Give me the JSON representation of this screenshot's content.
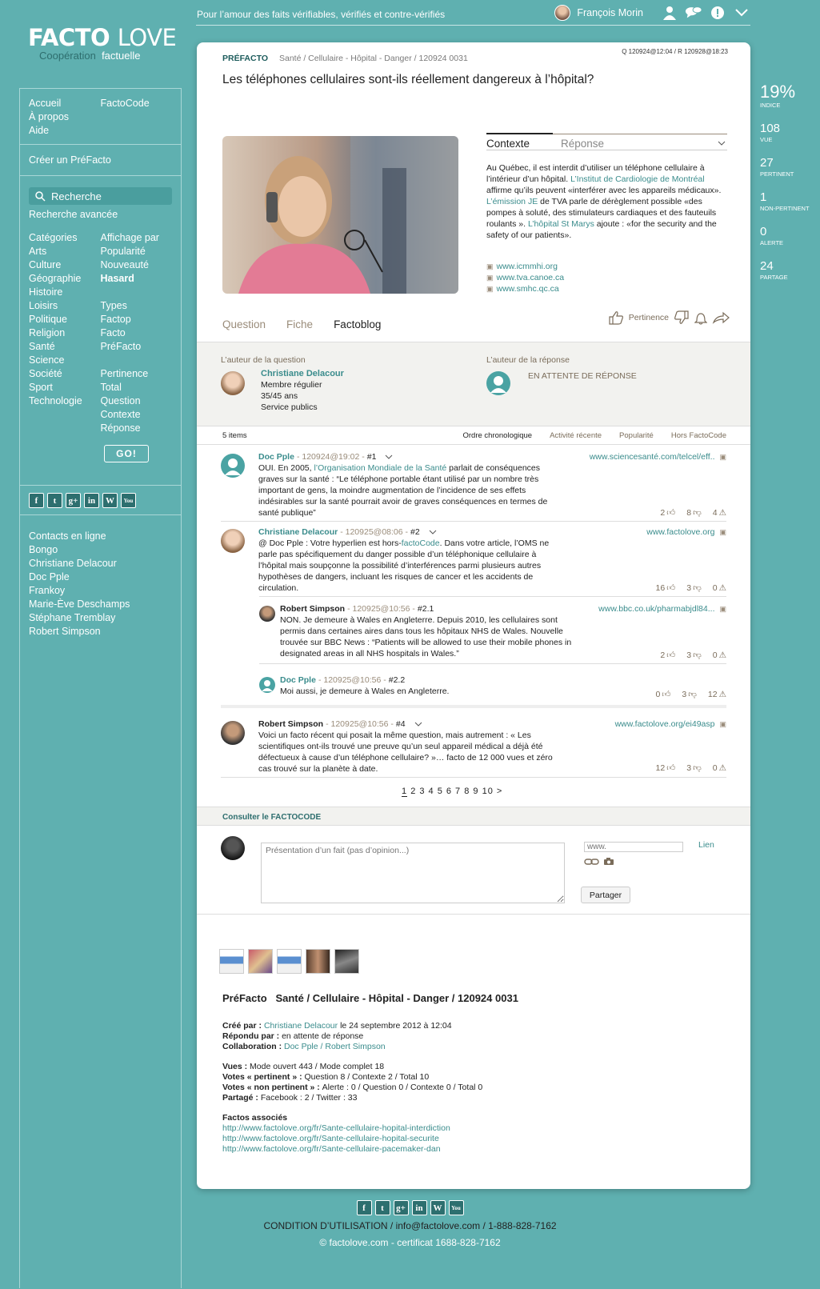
{
  "top": {
    "tagline": "Pour l’amour des faits vérifiables, vérifiés et contre-vérifiés",
    "user_name": "François Morin"
  },
  "logo": {
    "word1": "FACTO",
    "word2": "LOVE",
    "sub1": "Coopération",
    "sub2": "factuelle"
  },
  "sidebar": {
    "nav_left": [
      "Accueil",
      "À propos",
      "Aide"
    ],
    "nav_right": [
      "FactoCode"
    ],
    "create": "Créer un PréFacto",
    "search_label": "Recherche",
    "advanced_search": "Recherche avancée",
    "categories_title": "Catégories",
    "categories": [
      "Arts",
      "Culture",
      "Géographie",
      "Histoire",
      "Loisirs",
      "Politique",
      "Religion",
      "Santé",
      "Science",
      "Société",
      "Sport",
      "Technologie"
    ],
    "display_title": "Affichage par",
    "display": [
      "Popularité",
      "Nouveauté",
      "Hasard"
    ],
    "types_title": "Types",
    "types": [
      "Factop",
      "Facto",
      "PréFacto"
    ],
    "relevance_title": "Pertinence",
    "relevance": [
      "Total",
      "Question",
      "Contexte",
      "Réponse"
    ],
    "go_label": "GO!",
    "contacts_title": "Contacts en ligne",
    "contacts": [
      "Bongo",
      "Christiane Delacour",
      "Doc Pple",
      "Frankoy",
      "Marie-Ève Deschamps",
      "Stéphane Tremblay",
      "Robert Simpson"
    ]
  },
  "social_icons": [
    "f",
    "t",
    "g+",
    "in",
    "W",
    "You"
  ],
  "stats": [
    {
      "value": "19%",
      "label": "INDICE"
    },
    {
      "value": "108",
      "label": "VUE"
    },
    {
      "value": "27",
      "label": "PERTINENT"
    },
    {
      "value": "1",
      "label": "NON-PERTINENT"
    },
    {
      "value": "0",
      "label": "ALERTE"
    },
    {
      "value": "24",
      "label": "PARTAGE"
    }
  ],
  "question": {
    "type": "PRÉFACTO",
    "path": "Santé / Cellulaire - Hôpital - Danger / 120924 0031",
    "dates": "Q 120924@12:04 / R 120928@18:23",
    "title": "Les téléphones cellulaires sont-ils réellement dangereux à l’hôpital?"
  },
  "context": {
    "tab1": "Contexte",
    "tab2": "Réponse",
    "text_a": "Au Québec, il est interdit d’utiliser un téléphone cellulaire à l’intérieur d’un hôpital. ",
    "link_a": "L’Institut de Cardiologie de Montréal",
    "text_b": " affirme qu’ils peuvent «interférer avec les appareils médicaux». ",
    "link_b": "L’émission JE",
    "text_c": " de TVA parle de dérèglement possible «des pompes à soluté, des stimulateurs cardiaques et des fauteuils roulants ». ",
    "link_c": "L’hôpital St Marys",
    "text_d": " ajoute : «for the security and the safety of our patients».",
    "links": [
      "www.icmmhi.org",
      "www.tva.canoe.ca",
      "www.smhc.qc.ca"
    ]
  },
  "subtabs": [
    "Question",
    "Fiche",
    "Factoblog"
  ],
  "actions": {
    "pertinence": "Pertinence"
  },
  "authors": {
    "q_label": "L’auteur de la question",
    "q_name": "Christiane Delacour",
    "q_lines": [
      "Membre régulier",
      "35/45 ans",
      "Service publics"
    ],
    "r_label": "L’auteur de la réponse",
    "r_status": "EN ATTENTE DE RÉPONSE"
  },
  "sort": {
    "count": "5 items",
    "options": [
      "Ordre chronologique",
      "Activité récente",
      "Popularité",
      "Hors FactoCode"
    ]
  },
  "comments": [
    {
      "author": "Doc Pple",
      "meta": " - 120924@19:02 - ",
      "num": "#1",
      "url": "www.sciencesanté.com/telcel/eff..",
      "pre": "OUI. En 2005, ",
      "link": "l’Organisation Mondiale de la Santé",
      "post": " parlait de conséquences graves sur la santé : “Le téléphone portable étant utilisé par un nombre très important de gens, la moindre augmentation de l’incidence de ses effets indésirables sur la santé pourrait avoir de graves conséquences en termes de santé publique”",
      "up": "2",
      "down": "8",
      "alert": "4"
    },
    {
      "author": "Christiane Delacour",
      "meta": " - 120925@08:06 - ",
      "num": "#2",
      "url": "www.factolove.org",
      "pre": "@ Doc Pple : Votre hyperlien est hors-",
      "link": "factoCode",
      "post": ". Dans votre article, l’OMS ne parle pas spécifiquement du danger possible d’un téléphonique cellulaire à l’hôpital mais soupçonne la possibilité d’interférences parmi plusieurs autres hypothèses de dangers, incluant les risques de cancer et les accidents de circulation.",
      "up": "16",
      "down": "3",
      "alert": "0"
    },
    {
      "author": "Robert Simpson",
      "meta": " - 120925@10:56 - ",
      "num": "#2.1",
      "url": "www.bbc.co.uk/pharmabjdl84...",
      "pre": "NON. Je demeure à Wales en Angleterre. Depuis 2010, les cellulaires sont permis dans certaines aires dans tous les hôpitaux NHS de Wales. Nouvelle trouvée sur BBC News : “Patients will be allowed to use their mobile phones in designated areas in all NHS hospitals in Wales.”",
      "link": "",
      "post": "",
      "up": "2",
      "down": "3",
      "alert": "0"
    },
    {
      "author": "Doc Pple",
      "meta": " - 120925@10:56 - ",
      "num": "#2.2",
      "url": "",
      "pre": "Moi aussi, je demeure à Wales en Angleterre.",
      "link": "",
      "post": "",
      "up": "0",
      "down": "3",
      "alert": "12"
    },
    {
      "author": "Robert Simpson",
      "meta": " - 120925@10:56 - ",
      "num": "#4",
      "url": "www.factolove.org/ei49asp",
      "pre": "Voici un facto récent qui posait la même question, mais autrement : « Les scientifiques ont-ils trouvé une preuve qu’un seul appareil médical a déjà été défectueux à cause d’un téléphone cellulaire? »… facto de 12 000 vues et zéro cas trouvé sur la planète à date.",
      "link": "",
      "post": "",
      "up": "12",
      "down": "3",
      "alert": "0"
    }
  ],
  "pager": {
    "current": "1",
    "rest": "2 3 4 5 6 7 8 9 10  >"
  },
  "consult": "Consulter le FACTOCODE",
  "compose": {
    "placeholder": "Présentation d’un fait (pas d’opinion...)",
    "link_placeholder": "www.",
    "link_label": "Lien",
    "share": "Partager"
  },
  "info": {
    "title": "PréFacto   Santé / Cellulaire - Hôpital - Danger / 120924 0031",
    "created_label": "Créé par : ",
    "created_by": "Christiane Delacour",
    "created_date": " le 24 septembre 2012 à 12:04",
    "answered_label": "Répondu par : ",
    "answered_value": "en attente de réponse",
    "collab_label": "Collaboration : ",
    "collab_value": "Doc Pple / Robert Simpson",
    "views_label": "Vues : ",
    "views_value": "Mode ouvert 443 / Mode complet 18",
    "votes_p_label": "Votes « pertinent » : ",
    "votes_p_value": "Question 8 / Contexte 2 / Total 10",
    "votes_np_label": "Votes « non pertinent » : ",
    "votes_np_value": "Alerte : 0 / Question 0 / Contexte 0 / Total 0",
    "shared_label": "Partagé : ",
    "shared_value": "Facebook : 2 / Twitter : 33",
    "assoc_title": "Factos associés",
    "assoc": [
      "http://www.factolove.org/fr/Sante-cellulaire-hopital-interdiction",
      "http://www.factolove.org/fr/Sante-cellulaire-hopital-securite",
      "http://www.factolove.org/fr/Sante-cellulaire-pacemaker-dan"
    ]
  },
  "footer": {
    "line1": "CONDITION D’UTILISATION / info@factolove.com / 1-888-828-7162",
    "line2": "© factolove.com - certificat 1688-828-7162"
  },
  "colors": {
    "background": "#5fb0b0",
    "accent": "#3a8c8c",
    "muted": "#9a8c7a"
  }
}
